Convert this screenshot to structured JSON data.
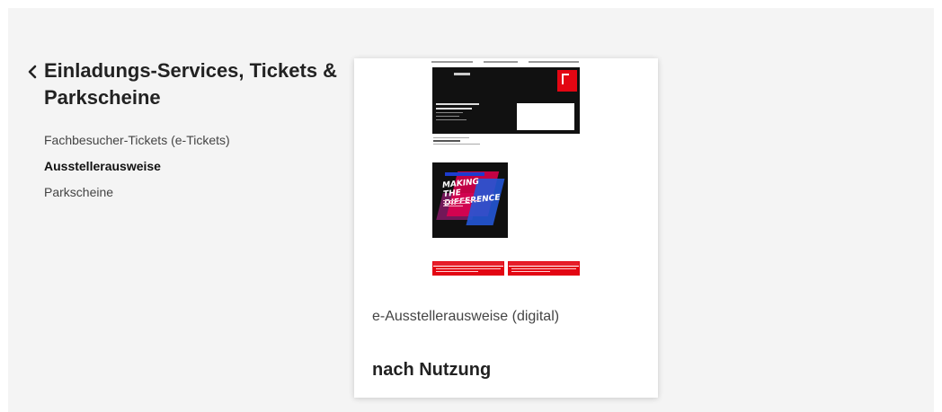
{
  "section": {
    "title": "Einladungs-Services, Tickets & Parkscheine",
    "back_icon": "chevron-left-icon"
  },
  "nav": {
    "items": [
      {
        "label": "Fachbesucher-Tickets (e-Tickets)",
        "active": false
      },
      {
        "label": "Ausstellerausweise",
        "active": true
      },
      {
        "label": "Parkscheine",
        "active": false
      }
    ]
  },
  "card": {
    "image_banner_text": "MAKING THE DIFFERENCE",
    "caption": "e-Ausstellerausweise (digital)",
    "heading": "nach Nutzung"
  },
  "colors": {
    "accent_red": "#e30613",
    "page_bg": "#f4f4f4",
    "card_bg": "#ffffff",
    "text": "#333333"
  }
}
